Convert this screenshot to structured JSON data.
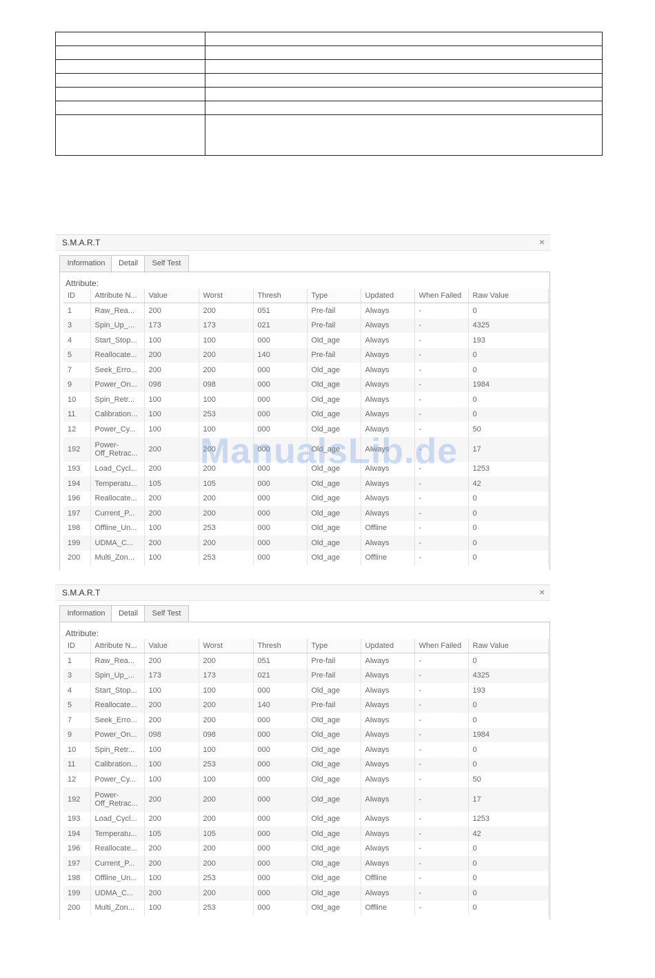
{
  "watermark": "ManualsLib.de",
  "dialog_title": "S.M.A.R.T",
  "close_symbol": "×",
  "tabs": [
    "Information",
    "Detail",
    "Self Test"
  ],
  "active_tab": "Detail",
  "attribute_label": "Attribute:",
  "columns": [
    "ID",
    "Attribute N...",
    "Value",
    "Worst",
    "Thresh",
    "Type",
    "Updated",
    "When Failed",
    "Raw Value"
  ],
  "rows": [
    [
      "1",
      "Raw_Rea...",
      "200",
      "200",
      "051",
      "Pre-fail",
      "Always",
      "-",
      "0"
    ],
    [
      "3",
      "Spin_Up_...",
      "173",
      "173",
      "021",
      "Pre-fail",
      "Always",
      "-",
      "4325"
    ],
    [
      "4",
      "Start_Stop...",
      "100",
      "100",
      "000",
      "Old_age",
      "Always",
      "-",
      "193"
    ],
    [
      "5",
      "Reallocate...",
      "200",
      "200",
      "140",
      "Pre-fail",
      "Always",
      "-",
      "0"
    ],
    [
      "7",
      "Seek_Erro...",
      "200",
      "200",
      "000",
      "Old_age",
      "Always",
      "-",
      "0"
    ],
    [
      "9",
      "Power_On...",
      "098",
      "098",
      "000",
      "Old_age",
      "Always",
      "-",
      "1984"
    ],
    [
      "10",
      "Spin_Retr...",
      "100",
      "100",
      "000",
      "Old_age",
      "Always",
      "-",
      "0"
    ],
    [
      "11",
      "Calibration...",
      "100",
      "253",
      "000",
      "Old_age",
      "Always",
      "-",
      "0"
    ],
    [
      "12",
      "Power_Cy...",
      "100",
      "100",
      "000",
      "Old_age",
      "Always",
      "-",
      "50"
    ],
    [
      "192",
      "Power-Off_Retrac...",
      "200",
      "200",
      "000",
      "Old_age",
      "Always",
      "-",
      "17"
    ],
    [
      "193",
      "Load_Cycl...",
      "200",
      "200",
      "000",
      "Old_age",
      "Always",
      "-",
      "1253"
    ],
    [
      "194",
      "Temperatu...",
      "105",
      "105",
      "000",
      "Old_age",
      "Always",
      "-",
      "42"
    ],
    [
      "196",
      "Reallocate...",
      "200",
      "200",
      "000",
      "Old_age",
      "Always",
      "-",
      "0"
    ],
    [
      "197",
      "Current_P...",
      "200",
      "200",
      "000",
      "Old_age",
      "Always",
      "-",
      "0"
    ],
    [
      "198",
      "Offline_Un...",
      "100",
      "253",
      "000",
      "Old_age",
      "Offline",
      "-",
      "0"
    ],
    [
      "199",
      "UDMA_C...",
      "200",
      "200",
      "000",
      "Old_age",
      "Always",
      "-",
      "0"
    ],
    [
      "200",
      "Multi_Zon...",
      "100",
      "253",
      "000",
      "Old_age",
      "Offline",
      "-",
      "0"
    ]
  ]
}
